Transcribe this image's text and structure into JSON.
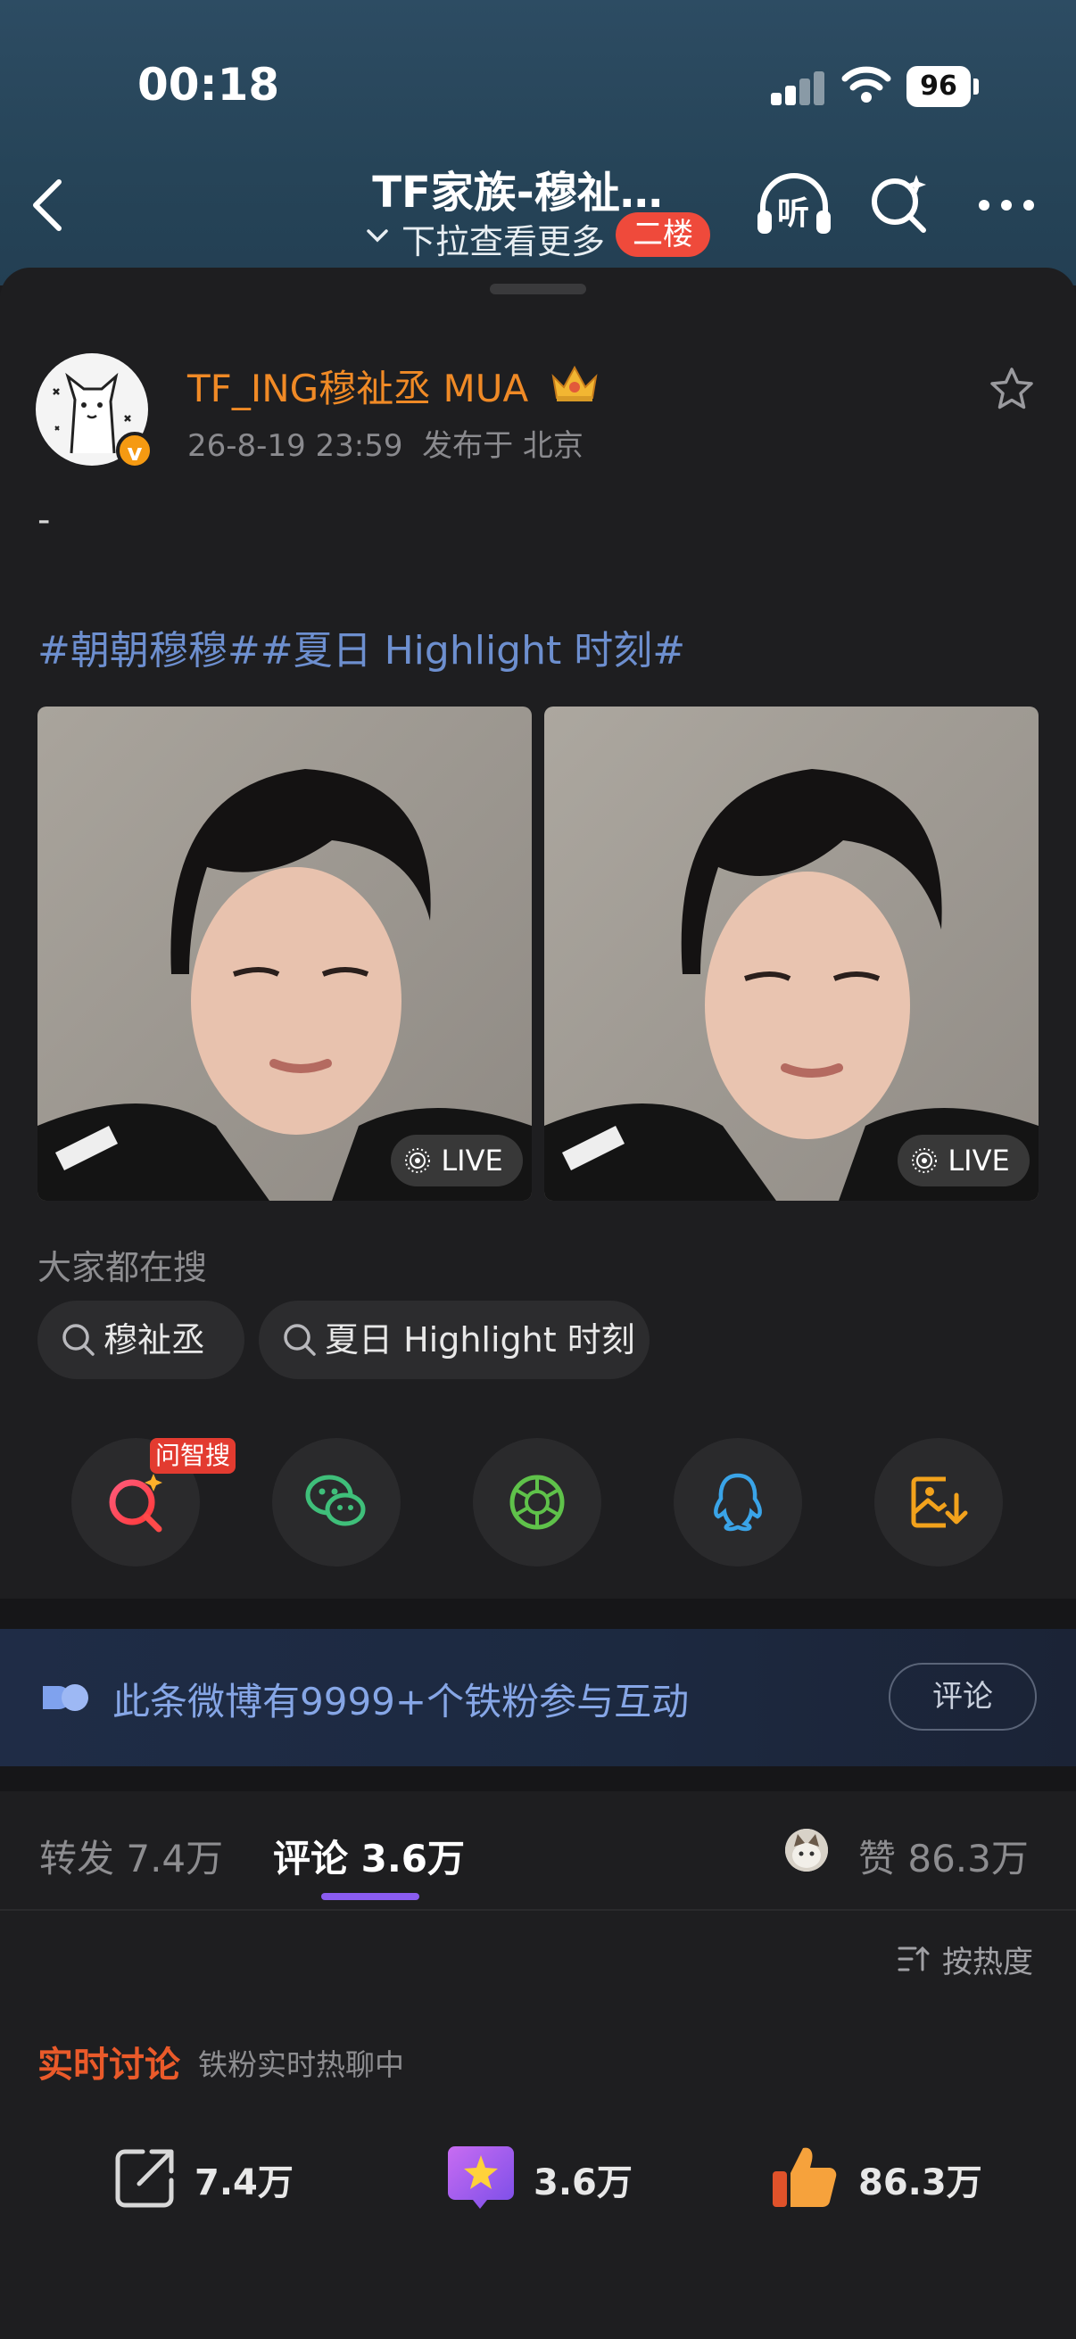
{
  "status_bar": {
    "time": "00:18",
    "battery": "96"
  },
  "nav": {
    "title": "TF家族-穆祉…",
    "subtitle": "下拉查看更多",
    "floor_badge": "二楼",
    "listen_label": "听"
  },
  "post": {
    "username": "TF_ING穆祉丞 MUA",
    "timestamp": "26-8-19 23:59",
    "location": "发布于 北京",
    "body": "-",
    "hashtags": "#朝朝穆穆##夏日 Highlight 时刻#",
    "images": [
      {
        "badge": "LIVE"
      },
      {
        "badge": "LIVE"
      }
    ]
  },
  "search_section": {
    "label": "大家都在搜",
    "chips": [
      "穆祉丞",
      "夏日 Highlight 时刻"
    ]
  },
  "share_row": {
    "ask_badge": "问智搜",
    "icons": [
      "ai-search-icon",
      "wechat-icon",
      "moments-icon",
      "qq-icon",
      "save-image-icon"
    ]
  },
  "banner": {
    "text": "此条微博有9999+个铁粉参与互动",
    "button": "评论"
  },
  "tabs": {
    "repost": "转发 7.4万",
    "comment": "评论 3.6万",
    "like": "赞 86.3万"
  },
  "sort_label": "按热度",
  "realtime": {
    "title": "实时讨论",
    "subtitle": "铁粉实时热聊中"
  },
  "bottom_bar": {
    "repost": "7.4万",
    "comment": "3.6万",
    "like": "86.3万"
  },
  "colors": {
    "username": "#f08a26",
    "hashtag": "#6d8fcf",
    "floor_badge": "#ef4a3b",
    "tab_underline": "#8a5cf0",
    "realtime_title": "#ea5a2a"
  }
}
